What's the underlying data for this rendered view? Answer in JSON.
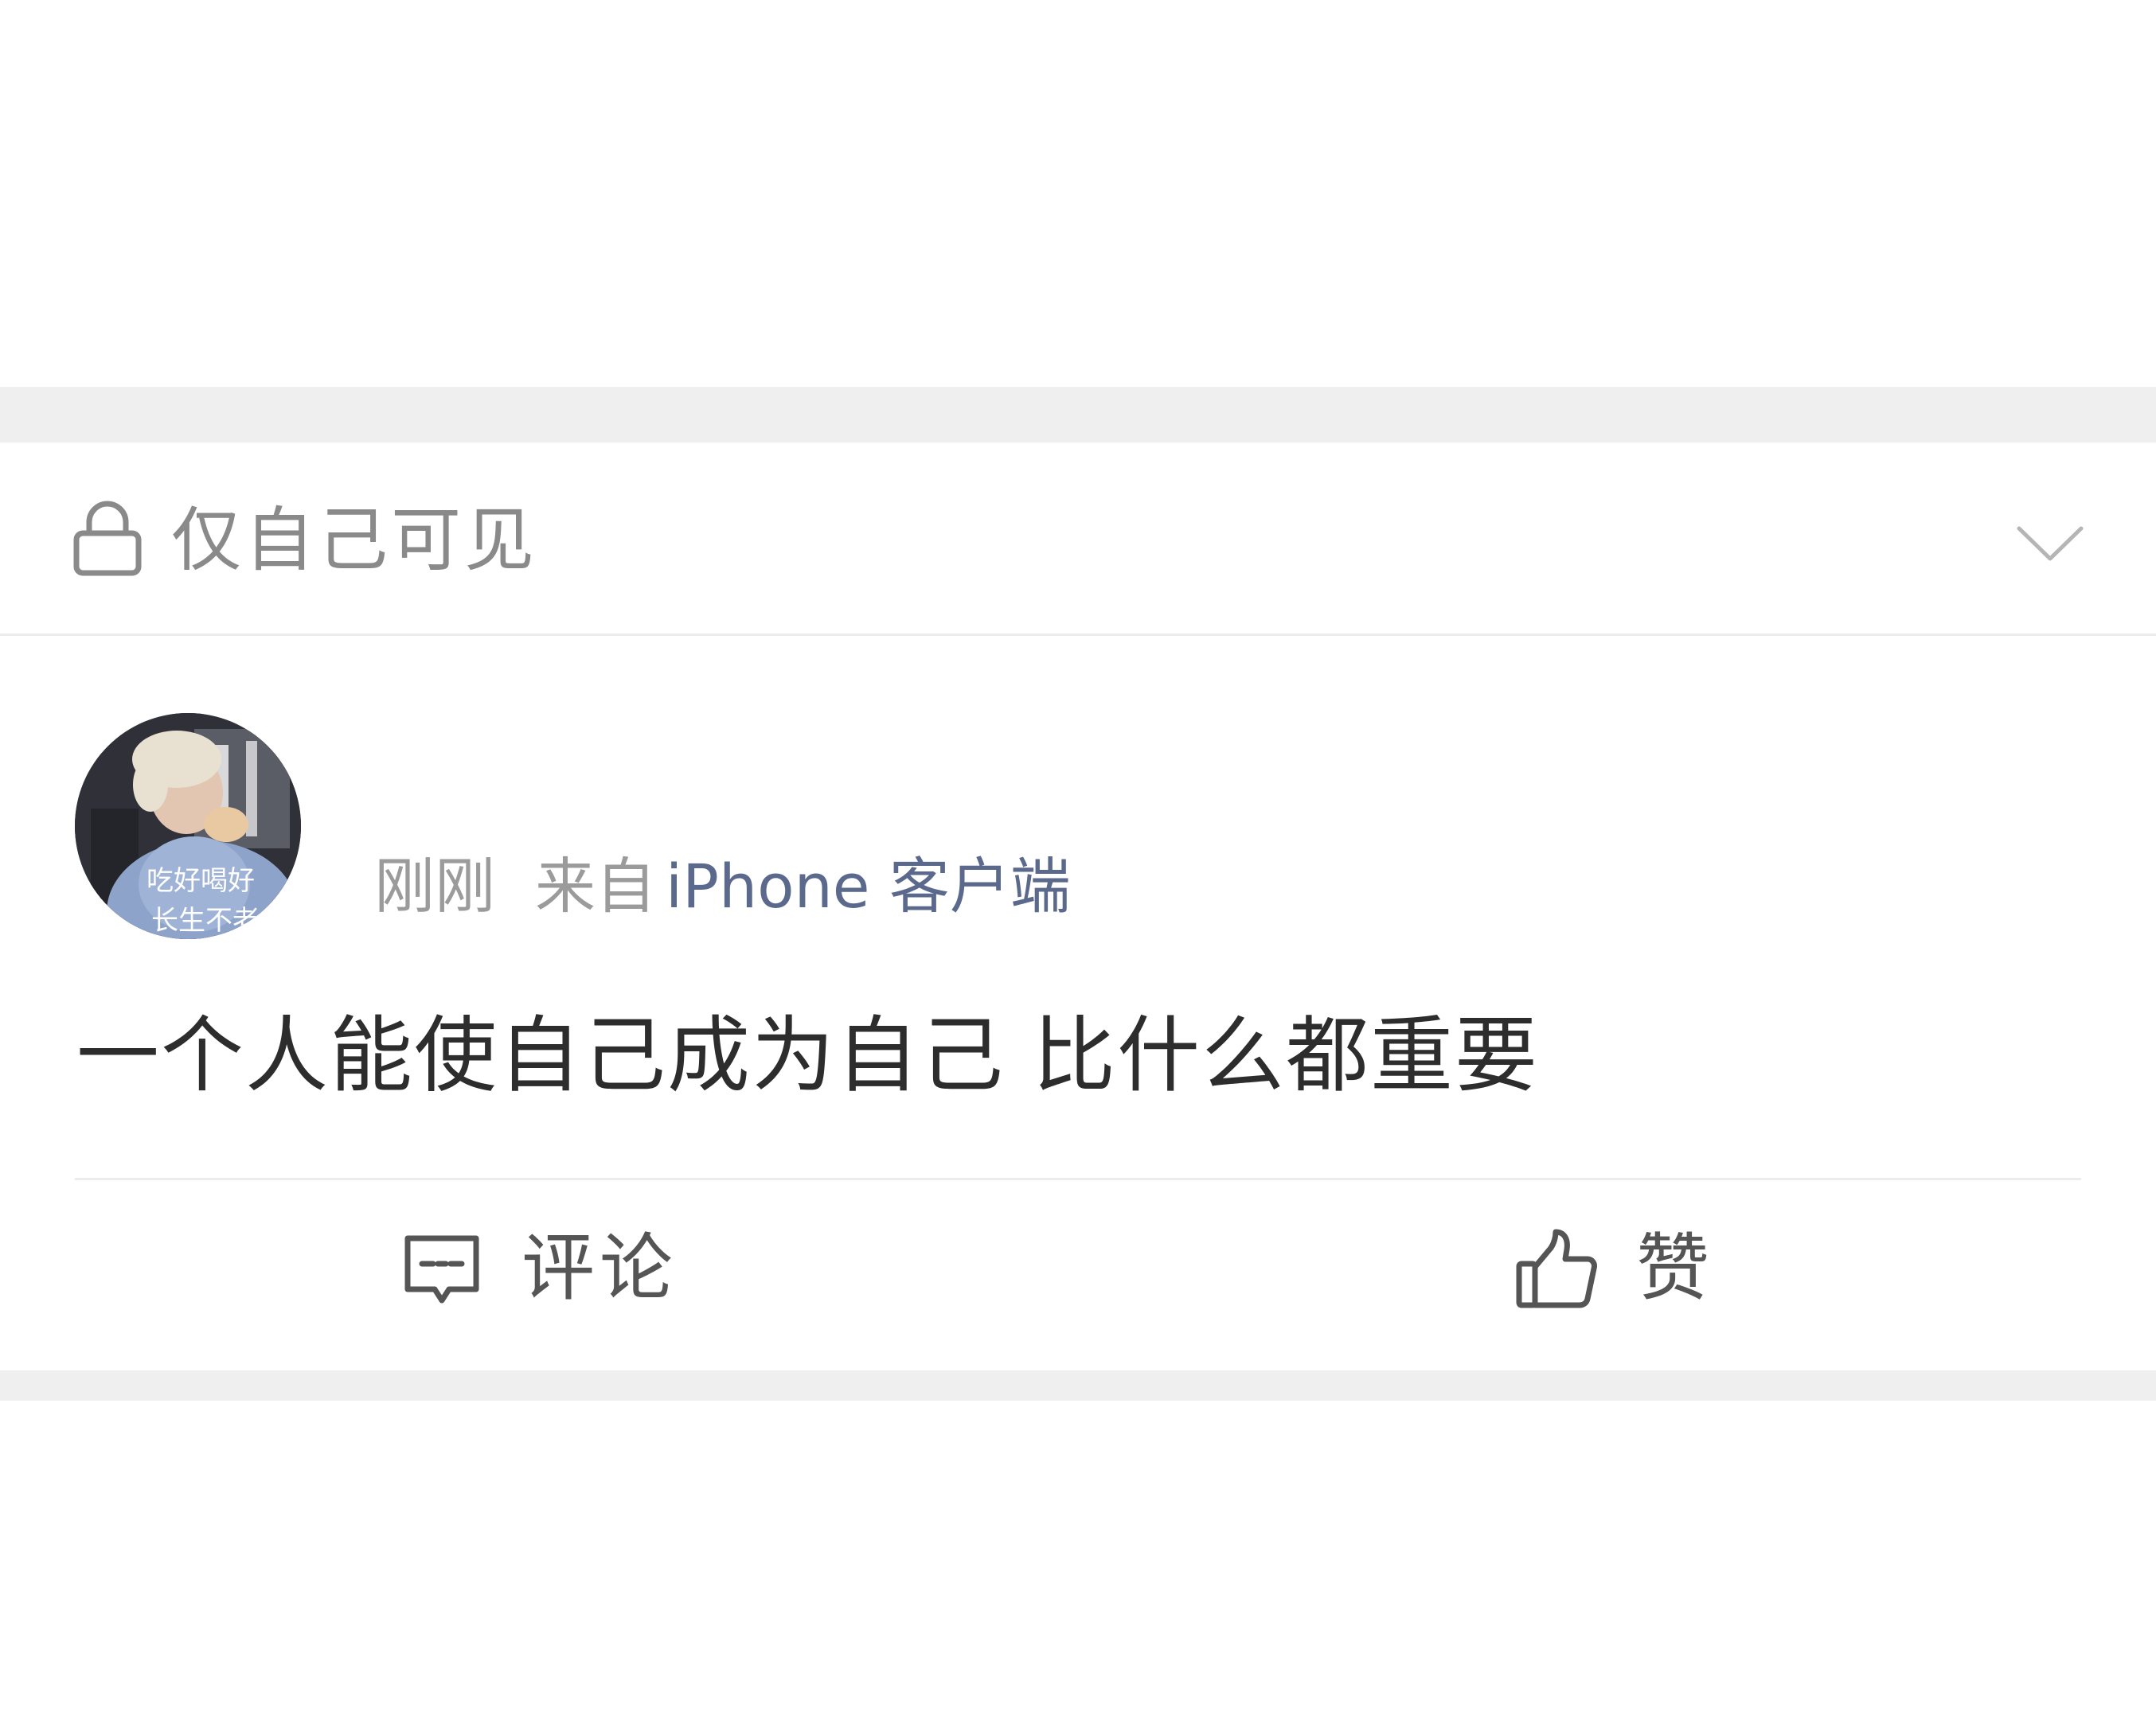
{
  "visibility": {
    "icon": "lock-icon",
    "label": "仅自己可见",
    "expand_icon": "chevron-down-icon"
  },
  "post": {
    "avatar": {
      "caption_line1": "吃好喝好",
      "caption_line2": "长生不老"
    },
    "time": "刚刚",
    "from_label": "来自",
    "source": "iPhone 客户端",
    "text": "一个人能使自己成为自己 比什么都重要"
  },
  "actions": {
    "comment": {
      "icon": "comment-icon",
      "label": "评论"
    },
    "like": {
      "icon": "thumbs-up-icon",
      "label": "赞"
    }
  },
  "colors": {
    "background": "#ffffff",
    "separator_band": "#efefef",
    "muted_text": "#8a8a8a",
    "link_blue": "#5b6a8c",
    "body_text": "#2d2d2d"
  }
}
